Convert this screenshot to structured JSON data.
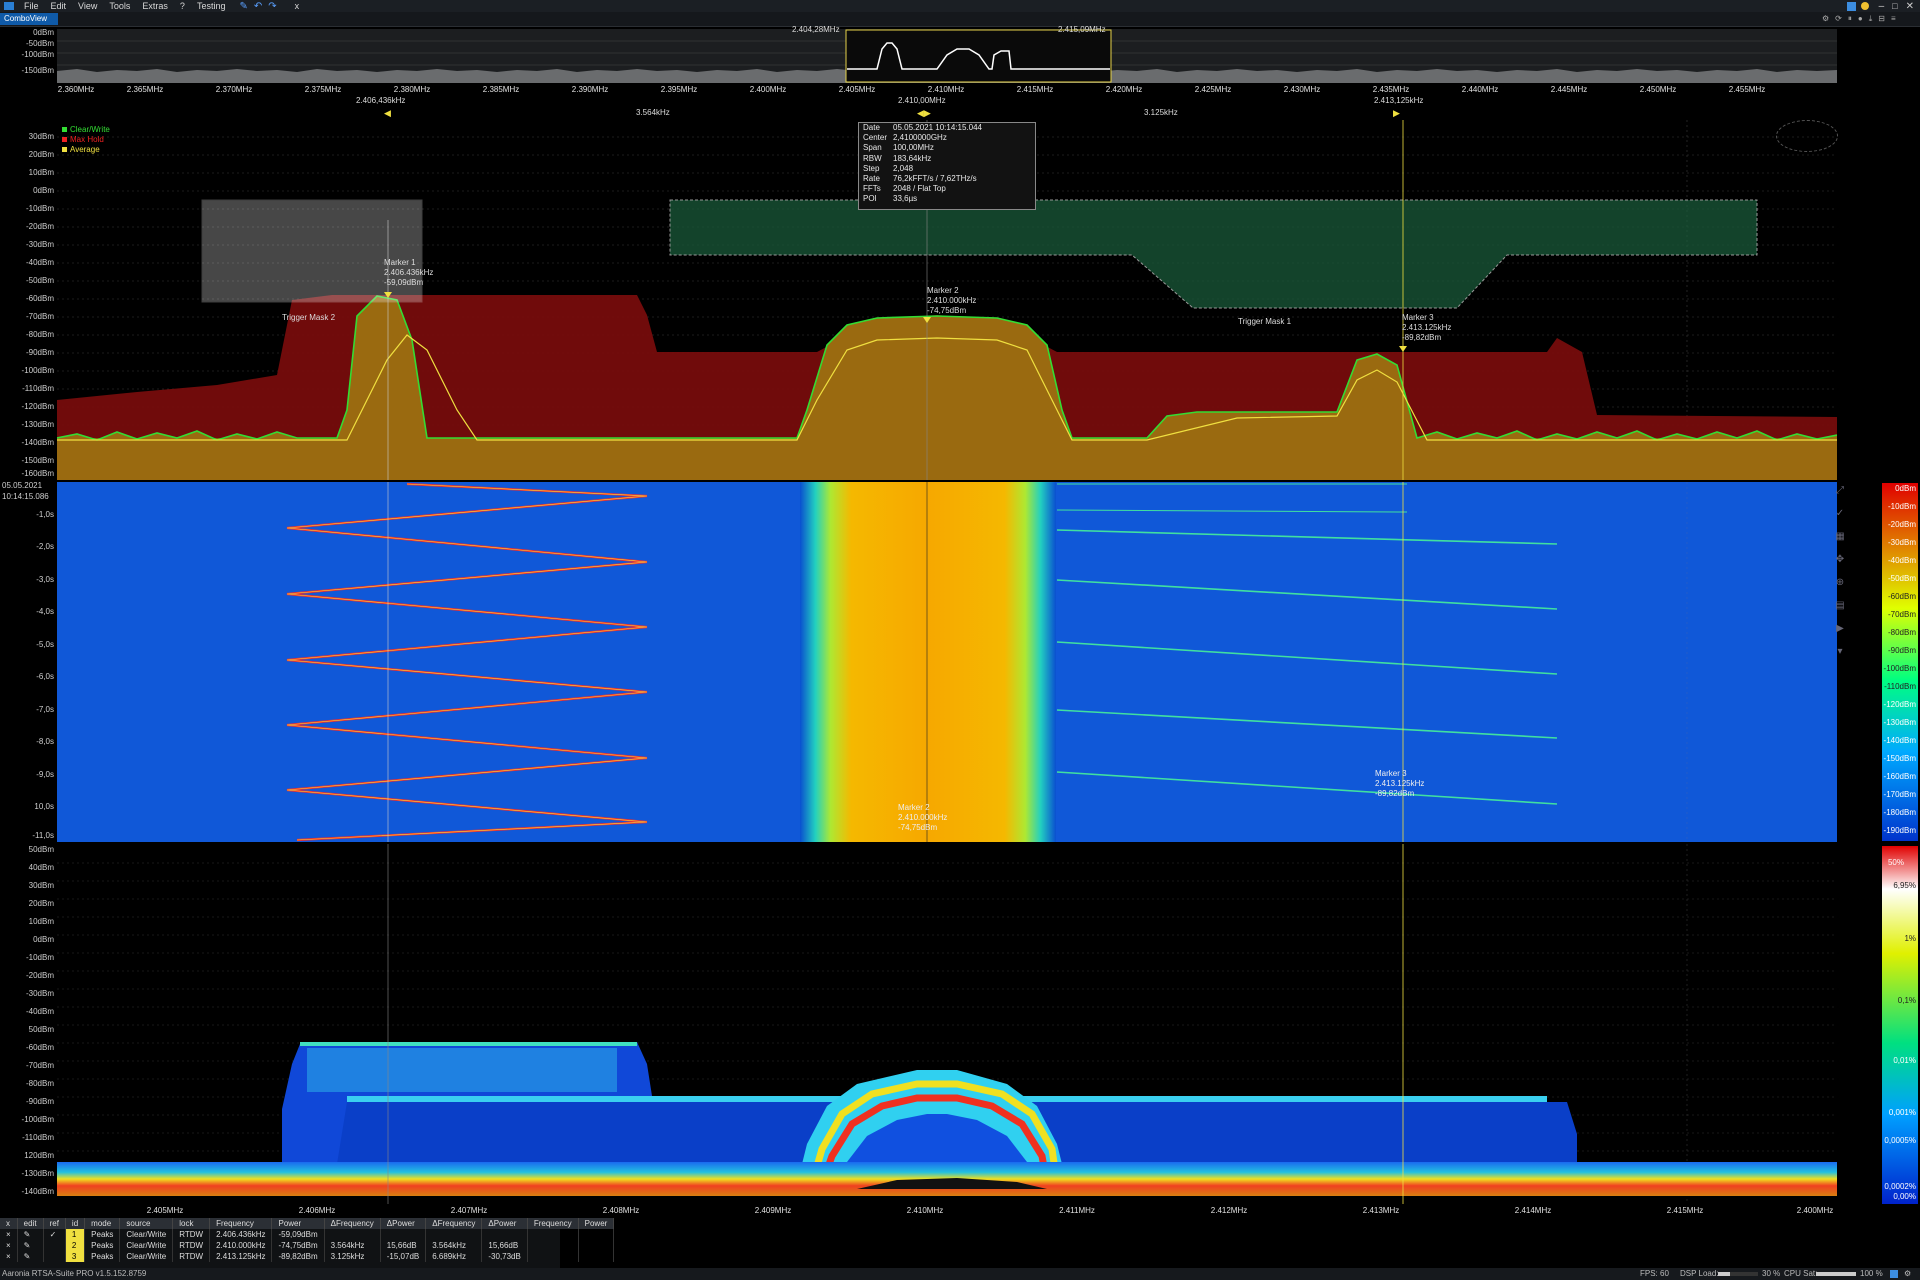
{
  "menu": {
    "items": [
      "File",
      "Edit",
      "View",
      "Tools",
      "Extras",
      "?",
      "Testing"
    ],
    "close_tab": "x"
  },
  "tabs": [
    {
      "label": "ComboView"
    }
  ],
  "overview": {
    "y_labels": [
      "0dBm",
      "-50dBm",
      "-100dBm",
      "-150dBm"
    ],
    "x_labels": [
      "2.360MHz",
      "2.365MHz",
      "2.370MHz",
      "2.375MHz",
      "2.380MHz",
      "2.385MHz",
      "2.390MHz",
      "2.395MHz",
      "2.400MHz",
      "2.405MHz",
      "2.410MHz",
      "2.415MHz",
      "2.420MHz",
      "2.425MHz",
      "2.430MHz",
      "2.435MHz",
      "2.440MHz",
      "2.445MHz",
      "2.450MHz",
      "2.455MHz"
    ],
    "span_left_label": "2.404,28MHz",
    "span_right_label": "2.415,09MHz",
    "center_label": "2.410,00MHz",
    "left_marker_label": "2.406,436kHz",
    "right_marker_label": "2.413,125kHz"
  },
  "delta_labels": {
    "left": "3.564kHz",
    "right": "3.125kHz"
  },
  "legend": [
    {
      "label": "Clear/Write",
      "color": "#33dd33"
    },
    {
      "label": "Max Hold",
      "color": "#ee2222"
    },
    {
      "label": "Average",
      "color": "#f0e040"
    }
  ],
  "spectrum": {
    "y_labels": [
      "30dBm",
      "20dBm",
      "10dBm",
      "0dBm",
      "-10dBm",
      "-20dBm",
      "-30dBm",
      "-40dBm",
      "-50dBm",
      "-60dBm",
      "-70dBm",
      "-80dBm",
      "-90dBm",
      "-100dBm",
      "-110dBm",
      "-120dBm",
      "-130dBm",
      "-140dBm",
      "-150dBm",
      "-160dBm"
    ]
  },
  "info": {
    "rows": [
      {
        "k": "Date",
        "v": "05.05.2021 10:14:15.044"
      },
      {
        "k": "Center",
        "v": "2,4100000GHz"
      },
      {
        "k": "Span",
        "v": "100,00MHz"
      },
      {
        "k": "RBW",
        "v": "183,64kHz"
      },
      {
        "k": "Step",
        "v": "2,048"
      },
      {
        "k": "Rate",
        "v": "76,2kFFT/s / 7,62THz/s"
      },
      {
        "k": "FFTs",
        "v": "2048 / Flat Top"
      },
      {
        "k": "POI",
        "v": "33,6µs"
      }
    ]
  },
  "markers": [
    {
      "name": "Marker 1",
      "freq": "2.406.436kHz",
      "power": "-59,09dBm"
    },
    {
      "name": "Marker 2",
      "freq": "2.410.000kHz",
      "power": "-74,75dBm"
    },
    {
      "name": "Marker 3",
      "freq": "2.413.125kHz",
      "power": "-89,82dBm"
    }
  ],
  "trigger_masks": [
    "Trigger Mask 2",
    "Trigger Mask 1"
  ],
  "waterfall": {
    "time_date": "05.05.2021",
    "time_clock": "10:14:15.086",
    "y_labels": [
      "-1,0s",
      "-2,0s",
      "-3,0s",
      "-4,0s",
      "-5,0s",
      "-6,0s",
      "-7,0s",
      "-8,0s",
      "-9,0s",
      "10,0s",
      "-11,0s"
    ],
    "scale_labels": [
      "0dBm",
      "-10dBm",
      "-20dBm",
      "-30dBm",
      "-40dBm",
      "-50dBm",
      "-60dBm",
      "-70dBm",
      "-80dBm",
      "-90dBm",
      "-100dBm",
      "-110dBm",
      "-120dBm",
      "-130dBm",
      "-140dBm",
      "-150dBm",
      "-160dBm",
      "-170dBm",
      "-180dBm",
      "-190dBm"
    ],
    "marker_readout": {
      "name": "Marker 3",
      "freq": "2.413.125kHz",
      "power": "-89,82dBm"
    },
    "marker2_readout": {
      "name": "Marker 2",
      "freq": "2.410.000kHz",
      "power": "-74,75dBm"
    }
  },
  "persistence": {
    "y_labels": [
      "50dBm",
      "40dBm",
      "30dBm",
      "20dBm",
      "10dBm",
      "0dBm",
      "-10dBm",
      "-20dBm",
      "-30dBm",
      "-40dBm",
      "50dBm",
      "-60dBm",
      "-70dBm",
      "-80dBm",
      "-90dBm",
      "-100dBm",
      "-110dBm",
      "120dBm",
      "-130dBm",
      "-140dBm"
    ],
    "x_labels": [
      "2.405MHz",
      "2.406MHz",
      "2.407MHz",
      "2.408MHz",
      "2.409MHz",
      "2.410MHz",
      "2.411MHz",
      "2.412MHz",
      "2.413MHz",
      "2.414MHz",
      "2.415MHz",
      "2.400MHz"
    ],
    "scale_labels": [
      "50%",
      "6,95%",
      "1%",
      "0,1%",
      "0,01%",
      "0,001%",
      "0,0005%",
      "0,0002%",
      "0,00%"
    ]
  },
  "marker_table": {
    "headers": [
      "x",
      "edit",
      "ref",
      "id",
      "mode",
      "source",
      "lock",
      "Frequency",
      "Power",
      "ΔFrequency",
      "ΔPower",
      "ΔFrequency",
      "ΔPower",
      "Frequency",
      "Power"
    ],
    "rows": [
      {
        "id": "1",
        "color": "#f0e040",
        "mode": "Peaks",
        "source": "Clear/Write",
        "lock": "RTDW",
        "freq": "2.406.436kHz",
        "power": "-59,09dBm",
        "dfreq": "",
        "dpower": "",
        "dfreq2": "",
        "dpower2": ""
      },
      {
        "id": "2",
        "color": "#f0e040",
        "mode": "Peaks",
        "source": "Clear/Write",
        "lock": "RTDW",
        "freq": "2.410.000kHz",
        "power": "-74,75dBm",
        "dfreq": "3.564kHz",
        "dpower": "15,66dB",
        "dfreq2": "3.564kHz",
        "dpower2": "15,66dB"
      },
      {
        "id": "3",
        "color": "#f0e040",
        "mode": "Peaks",
        "source": "Clear/Write",
        "lock": "RTDW",
        "freq": "2.413.125kHz",
        "power": "-89,82dBm",
        "dfreq": "3.125kHz",
        "dpower": "-15,07dB",
        "dfreq2": "6.689kHz",
        "dpower2": "-30,73dB"
      }
    ]
  },
  "status": {
    "app": "Aaronia RTSA-Suite PRO v1.5.152.8759",
    "fps": "FPS: 60",
    "dsp": "DSP Load:",
    "dsp_val": "30 %",
    "cpu": "CPU Sat:",
    "cpu_val": "100 %"
  }
}
